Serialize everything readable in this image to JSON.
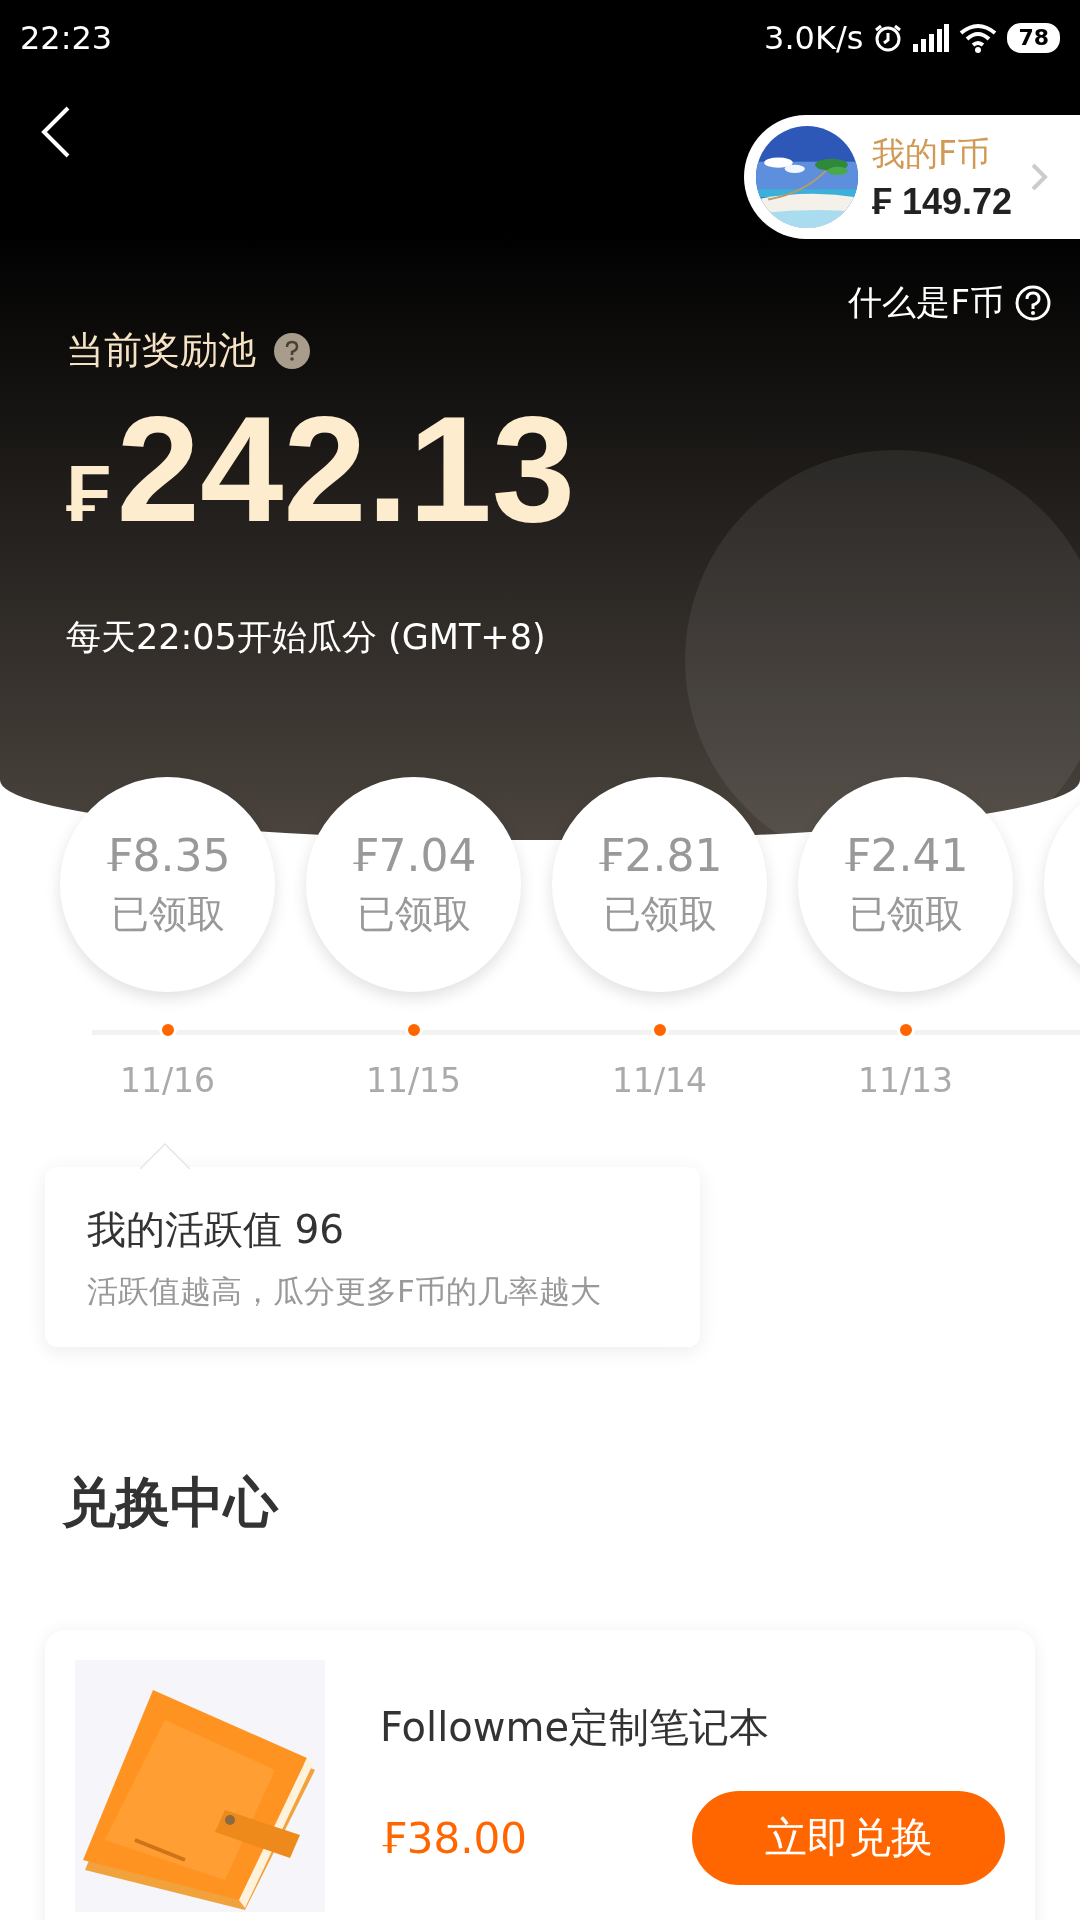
{
  "status_bar": {
    "time": "22:23",
    "network_speed": "3.0K/s",
    "battery": "78"
  },
  "coin_card": {
    "label": "我的F币",
    "amount": "₣ 149.72"
  },
  "help_link": "什么是F币",
  "pool": {
    "label": "当前奖励池",
    "currency": "₣",
    "amount": "242.13",
    "schedule": "每天22:05开始瓜分 (GMT+8)"
  },
  "rewards": [
    {
      "amount": "₣8.35",
      "status": "已领取",
      "date": "11/16"
    },
    {
      "amount": "₣7.04",
      "status": "已领取",
      "date": "11/15"
    },
    {
      "amount": "₣2.81",
      "status": "已领取",
      "date": "11/14"
    },
    {
      "amount": "₣2.41",
      "status": "已领取",
      "date": "11/13"
    }
  ],
  "activity_tip": {
    "title": "我的活跃值 96",
    "subtitle": "活跃值越高，瓜分更多F币的几率越大"
  },
  "exchange": {
    "title": "兑换中心",
    "items": [
      {
        "kind": "picture",
        "name": "Followme定制笔记本",
        "price": "₣38.00",
        "button": "立即兑换"
      }
    ]
  }
}
